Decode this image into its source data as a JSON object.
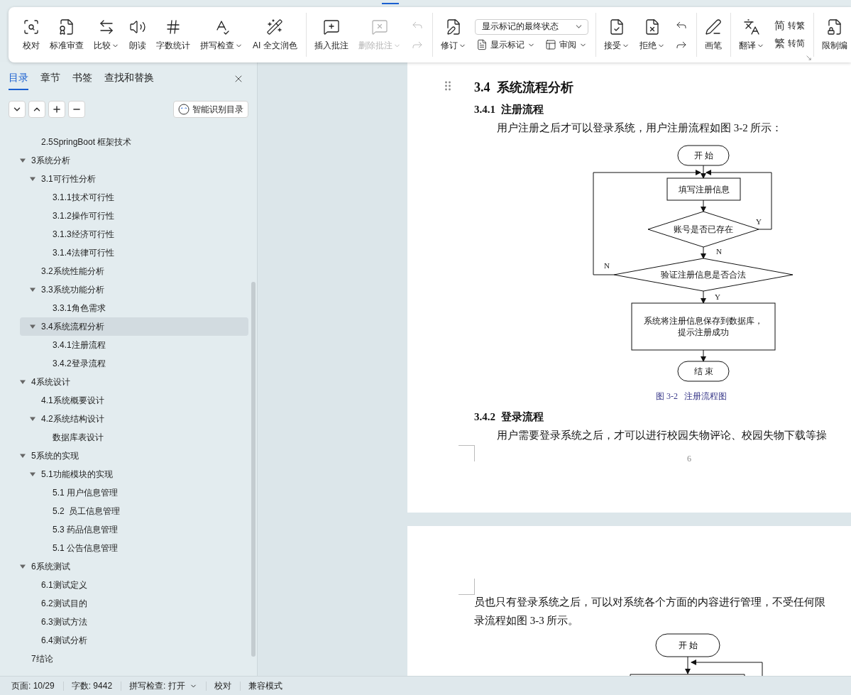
{
  "ribbon": {
    "groups": [
      {
        "items": [
          {
            "kind": "large",
            "label": "校对",
            "dropdown": false,
            "disabled": false
          },
          {
            "kind": "large",
            "label": "标准审查",
            "dropdown": false,
            "disabled": false
          },
          {
            "kind": "large",
            "label": "比较",
            "dropdown": true,
            "disabled": false
          },
          {
            "kind": "large",
            "label": "朗读",
            "dropdown": false,
            "disabled": false
          },
          {
            "kind": "large",
            "label": "字数统计",
            "dropdown": false,
            "disabled": false
          },
          {
            "kind": "large",
            "label": "拼写检查",
            "dropdown": true,
            "disabled": false
          },
          {
            "kind": "large",
            "label": "AI 全文润色",
            "dropdown": false,
            "disabled": false
          }
        ]
      },
      {
        "items": [
          {
            "kind": "large",
            "label": "插入批注",
            "dropdown": false,
            "disabled": false
          },
          {
            "kind": "large",
            "label": "删除批注",
            "dropdown": true,
            "disabled": true
          },
          {
            "kind": "icon_pair",
            "disabled": true
          }
        ]
      },
      {
        "items": [
          {
            "kind": "large",
            "label": "修订",
            "dropdown": true,
            "disabled": false
          },
          {
            "kind": "select_stack",
            "value": "显示标记的最终状态",
            "buttons": [
              {
                "label": "显示标记",
                "dropdown": true
              },
              {
                "label": "审阅",
                "dropdown": true
              }
            ]
          }
        ]
      },
      {
        "items": [
          {
            "kind": "large",
            "label": "接受",
            "dropdown": true,
            "disabled": false
          },
          {
            "kind": "large",
            "label": "拒绝",
            "dropdown": true,
            "disabled": false
          },
          {
            "kind": "icon_pair",
            "disabled": false
          }
        ]
      },
      {
        "items": [
          {
            "kind": "large",
            "label": "画笔",
            "dropdown": false,
            "disabled": false
          }
        ]
      },
      {
        "items": [
          {
            "kind": "large",
            "label": "翻译",
            "dropdown": true,
            "disabled": false
          },
          {
            "kind": "text_stack",
            "buttons": [
              {
                "glyph": "简",
                "label": "转繁"
              },
              {
                "glyph": "繁",
                "label": "转简"
              }
            ]
          }
        ]
      },
      {
        "items": [
          {
            "kind": "large",
            "label": "限制编",
            "dropdown": false,
            "disabled": false
          }
        ]
      }
    ]
  },
  "sidebar": {
    "tabs": [
      {
        "label": "目录",
        "selected": true
      },
      {
        "label": "章节",
        "selected": false
      },
      {
        "label": "书签",
        "selected": false
      },
      {
        "label": "查找和替换",
        "selected": false
      }
    ],
    "smart_button": "智能识别目录",
    "toc": [
      {
        "children": [
          {
            "label": "2.5SpringBoot 框架技术",
            "selected": false
          }
        ]
      },
      {
        "label": "3系统分析",
        "expanded": true,
        "selected": false,
        "children": [
          {
            "label": "3.1可行性分析",
            "expanded": true,
            "selected": false,
            "children": [
              {
                "label": "3.1.1技术可行性",
                "selected": false
              },
              {
                "label": "3.1.2操作可行性",
                "selected": false
              },
              {
                "label": "3.1.3经济可行性",
                "selected": false
              },
              {
                "label": "3.1.4法律可行性",
                "selected": false
              }
            ]
          },
          {
            "label": "3.2系统性能分析",
            "selected": false
          },
          {
            "label": "3.3系统功能分析",
            "expanded": true,
            "selected": false,
            "children": [
              {
                "label": "3.3.1角色需求",
                "selected": false
              }
            ]
          },
          {
            "label": "3.4系统流程分析",
            "expanded": true,
            "selected": true,
            "children": [
              {
                "label": "3.4.1注册流程",
                "selected": false
              },
              {
                "label": "3.4.2登录流程",
                "selected": false
              }
            ]
          }
        ]
      },
      {
        "label": "4系统设计",
        "expanded": true,
        "selected": false,
        "children": [
          {
            "label": "4.1系统概要设计",
            "selected": false
          },
          {
            "label": "4.2系统结构设计",
            "expanded": true,
            "selected": false,
            "children": [
              {
                "label": "数据库表设计",
                "selected": false
              }
            ]
          }
        ]
      },
      {
        "label": "5系统的实现",
        "expanded": true,
        "selected": false,
        "children": [
          {
            "label": "5.1功能模块的实现",
            "expanded": true,
            "selected": false,
            "children": [
              {
                "label": "5.1 用户信息管理",
                "selected": false
              },
              {
                "label": "5.2  员工信息管理",
                "selected": false
              },
              {
                "label": "5.3 药品信息管理",
                "selected": false
              },
              {
                "label": "5.1 公告信息管理",
                "selected": false
              }
            ]
          }
        ]
      },
      {
        "label": "6系统测试",
        "expanded": true,
        "selected": false,
        "children": [
          {
            "label": "6.1测试定义",
            "selected": false
          },
          {
            "label": "6.2测试目的",
            "selected": false
          },
          {
            "label": "6.3测试方法",
            "selected": false
          },
          {
            "label": "6.4测试分析",
            "selected": false
          }
        ]
      },
      {
        "label": "7结论",
        "selected": false
      }
    ]
  },
  "document": {
    "pages": [
      {
        "page_number": "6",
        "blocks": [
          {
            "kind": "heading2",
            "text": "3.4  系统流程分析"
          },
          {
            "kind": "heading3",
            "text": "3.4.1  注册流程"
          },
          {
            "kind": "paragraph",
            "text": "用户注册之后才可以登录系统，用户注册流程如图 3-2 所示："
          },
          {
            "kind": "flowchart",
            "nodes": [
              {
                "kind": "terminal",
                "lines": [
                  "开 始"
                ]
              },
              {
                "kind": "process",
                "lines": [
                  "填写注册信息"
                ]
              },
              {
                "kind": "decision",
                "lines": [
                  "账号是否已存在"
                ]
              },
              {
                "kind": "decision",
                "lines": [
                  "验证注册信息是否合法"
                ]
              },
              {
                "kind": "process",
                "lines": [
                  "系统将注册信息保存到数据库，",
                  "提示注册成功"
                ]
              },
              {
                "kind": "terminal",
                "lines": [
                  "结 束"
                ]
              }
            ],
            "edge_labels": [
              "Y",
              "N",
              "N",
              "Y"
            ]
          },
          {
            "kind": "caption",
            "text": "图 3-2   注册流程图"
          },
          {
            "kind": "heading3",
            "text": "3.4.2  登录流程"
          },
          {
            "kind": "paragraph",
            "text": "用户需要登录系统之后，才可以进行校园失物评论、校园失物下载等操"
          }
        ]
      },
      {
        "blocks": [
          {
            "kind": "continued",
            "text": "员也只有登录系统之后，可以对系统各个方面的内容进行管理，不受任何限"
          },
          {
            "kind": "continued",
            "text": "录流程如图 3-3 所示。"
          },
          {
            "kind": "flowchart_fragment",
            "nodes": [
              {
                "kind": "terminal",
                "lines": [
                  "开 始"
                ]
              },
              {
                "kind": "process"
              }
            ]
          }
        ]
      }
    ]
  },
  "status_bar": [
    {
      "text": "页面: 10/29",
      "dropdown": false
    },
    {
      "text": "字数: 9442",
      "dropdown": false
    },
    {
      "text": "拼写检查: 打开",
      "dropdown": true
    },
    {
      "text": "校对",
      "dropdown": false
    },
    {
      "text": "兼容模式",
      "dropdown": false
    }
  ]
}
